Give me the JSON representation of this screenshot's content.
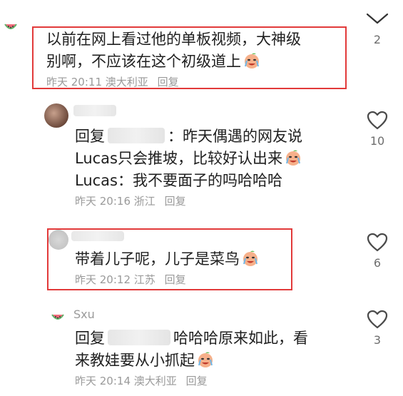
{
  "icons": {
    "chevron": "chevron-down-icon",
    "heart": "heart-outline-icon",
    "watermelon": "watermelon-avatar-icon",
    "emoji": "crying-laughing-peach-emoji"
  },
  "colors": {
    "highlight": "#e23a3a",
    "meta_text": "#9a9a9a"
  },
  "comments": [
    {
      "lines": [
        "以前在网上看过他的单板视频，大神级",
        "别啊，不应该在这个初级道上"
      ],
      "time": "昨天 20:11",
      "location": "澳大利亚",
      "reply_label": "回复",
      "like_count": "2"
    },
    {
      "reply_prefix": "回复",
      "line1_rest": "：昨天偶遇的网友说",
      "line2": "Lucas只会推坡，比较好认出来",
      "line3": "Lucas：我不要面子的吗哈哈哈",
      "time": "昨天 20:16",
      "location": "浙江",
      "reply_label": "回复",
      "like_count": "10"
    },
    {
      "line1": "带着儿子呢，儿子是菜鸟",
      "time": "昨天 20:12",
      "location": "江苏",
      "reply_label": "回复",
      "like_count": "6"
    },
    {
      "username": "Sxu",
      "reply_prefix": "回复",
      "line1_rest": "哈哈哈原来如此，看",
      "line2": "来教娃要从小抓起",
      "time": "昨天 20:14",
      "location": "澳大利亚",
      "reply_label": "回复",
      "like_count": "3"
    }
  ]
}
